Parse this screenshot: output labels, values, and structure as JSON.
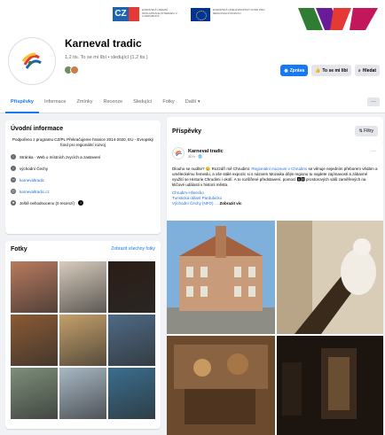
{
  "banner": {
    "cz_logo_left": "CZ",
    "cz_logo_right": "PL",
    "program_text": "EVROPSKÁ ÚZEMNÍ SPOLUPRÁCE INTERREG V-A REPUBLIKA",
    "eu_text": "EVROPSKÁ UNIE EVROPSKÝ FOND PRO REGIONÁLNÍ ROZVOJ",
    "colors": {
      "cz": "#1d64b0",
      "pl": "#e53935",
      "eu": "#003399"
    }
  },
  "page": {
    "name": "Karneval tradic",
    "stats": "1,2 tis. To se mi líbí • sledující (1,2 tis.)"
  },
  "actions": {
    "follow": "Zprávа",
    "like": "To se mi líbí",
    "search": "Hledat"
  },
  "tabs": [
    {
      "label": "Příspěvky",
      "active": true
    },
    {
      "label": "Informace"
    },
    {
      "label": "Zmínky"
    },
    {
      "label": "Recenze"
    },
    {
      "label": "Sledující"
    },
    {
      "label": "Fotky"
    },
    {
      "label": "Další ▾"
    }
  ],
  "tab_more": "···",
  "intro": {
    "title": "Úvodní informace",
    "description": "Podpořeno z programu CZ/PL Překračujeme hranice 2014-2020, EU - Evropský fond pro regionální rozvoj",
    "rows": [
      {
        "icon": "info-icon",
        "text": "Stránka · Web o místních zvycích a zastavení",
        "link": false
      },
      {
        "icon": "location-icon",
        "text": "východní Čechy",
        "link": false
      },
      {
        "icon": "link-icon",
        "text": "karnevaltradic",
        "link": true
      },
      {
        "icon": "instagram-icon",
        "text": "karnevaltradic.cz",
        "link": true
      },
      {
        "icon": "star-icon",
        "text": "Ještě nehodnoceno (0 recenzí)",
        "link": false
      }
    ]
  },
  "photos": {
    "title": "Fotky",
    "see_all": "Zobrazit všechny fotky",
    "items": [
      {
        "name": "building-photo",
        "color": "#b87a5e"
      },
      {
        "name": "statue-photo",
        "color": "#d8ccbd"
      },
      {
        "name": "dark-room-photo",
        "color": "#2b1d15"
      },
      {
        "name": "workshop-photo",
        "color": "#8a5a34"
      },
      {
        "name": "museum-hall-photo",
        "color": "#c5a06a"
      },
      {
        "name": "exhibit-photo",
        "color": "#4e6a85"
      },
      {
        "name": "street-photo",
        "color": "#7d8f7a"
      },
      {
        "name": "table-photo",
        "color": "#a8b8c5"
      },
      {
        "name": "glass-photo",
        "color": "#3a6e8e"
      }
    ]
  },
  "posts": {
    "title": "Příspěvky",
    "filter": "Filtry"
  },
  "post": {
    "author": "Karneval tradic",
    "time": "20 h · 🌐",
    "more": "···",
    "text_1": "Dlouho se nudíte? 😉 Rozzáří mě Chrudimi: ",
    "text_link": "Regionální muzeum v Chrudimi",
    "text_2": " se věnuje nejedním přeborem vědám a uměleckému řemeslu, a vše stálé expozic si ",
    "text_3": "s názvem Mozaika dějin regionu tu najdete zajímavosti a zábavné využití se Historie Chrudimi i okolí. A to rozšířené představení, pomocí 🅰🅱 prostorových sálů zaměřených na klíčové události v historii města.",
    "tag_1": "Chrudim-Hlinecko",
    "tag_2": "Turistická oblast Pardubicko",
    "tag_3": "Východní Čechy (NFO)",
    "see_more": "Zobrazit víc"
  }
}
